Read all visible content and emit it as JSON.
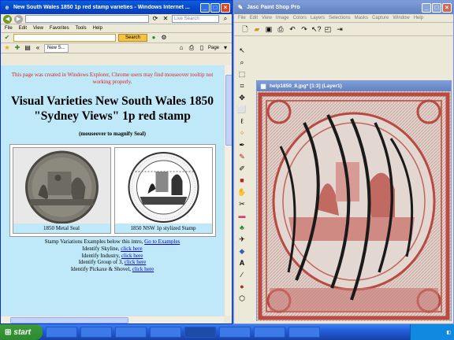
{
  "ie": {
    "title": "New South Wales 1850 1p red stamp varieties - Windows Internet ...",
    "menu": [
      "File",
      "Edit",
      "View",
      "Favorites",
      "Tools",
      "Help"
    ],
    "search_placeholder": "Live Search",
    "go_button": "Search",
    "tab_label": "New S...",
    "page_menu": "Page",
    "page": {
      "warning": "This page was created in Windows Explorer, Chrome users may find mouseover tooltip not working properly.",
      "heading": "Visual Varieties New South Wales 1850 \"Sydney Views\" 1p red stamp",
      "subheading": "(mouseover to magnify Seal)",
      "fig1_caption": "1850 Metal Seal",
      "fig2_caption": "1850 NSW 1p stylized Stamp",
      "intro_text": "Stamp Variations Examples below this intro,",
      "intro_link": "Go to Examples",
      "items": [
        {
          "text": "Identify Skyline,",
          "link": "click here"
        },
        {
          "text": "Identify Industry,",
          "link": "click here"
        },
        {
          "text": "Identify Group of 3,",
          "link": "click here"
        },
        {
          "text": "Identify Pickaxe & Shovel,",
          "link": "click here"
        }
      ]
    }
  },
  "psp": {
    "title": "Jasc Paint Shop Pro",
    "menu": [
      "File",
      "Edit",
      "View",
      "Image",
      "Colors",
      "Layers",
      "Selections",
      "Masks",
      "Capture",
      "Window",
      "Help"
    ],
    "image_window_title": "help1850_8.jpg* [1:3] (Layer1)"
  },
  "taskbar": {
    "start_label": "start"
  },
  "colors": {
    "page_bg": "#bfe8f8",
    "warning": "#e02020",
    "link": "#0000cc",
    "stamp_red": "#b83a34"
  }
}
